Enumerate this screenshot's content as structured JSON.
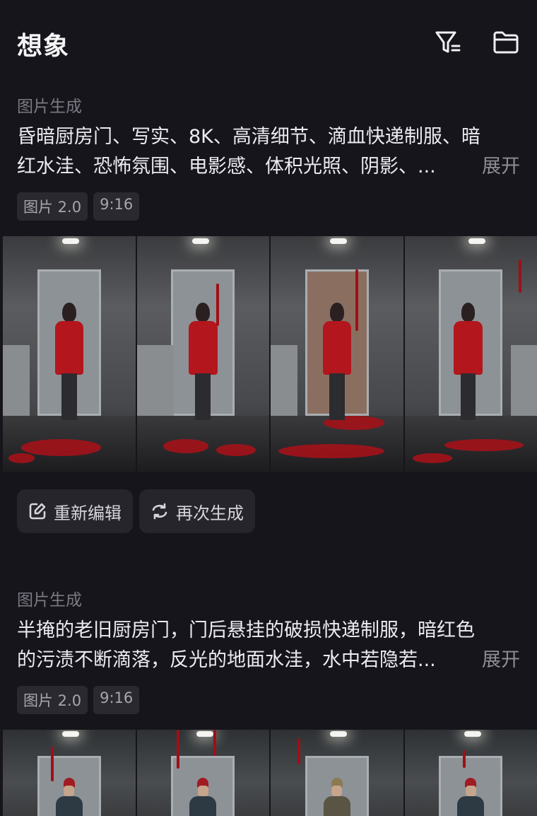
{
  "header": {
    "title": "想象",
    "filter_icon": "filter-icon",
    "folder_icon": "folder-icon"
  },
  "items": [
    {
      "label": "图片生成",
      "prompt_line1": "昏暗厨房门、写实、8K、高清细节、滴血快递制服、暗",
      "prompt_line2": "红水洼、恐怖氛围、电影感、体积光照、阴影、...",
      "expand": "展开",
      "tags": [
        "图片 2.0",
        "9:16"
      ],
      "actions": {
        "edit": "重新编辑",
        "regenerate": "再次生成"
      }
    },
    {
      "label": "图片生成",
      "prompt_line1": "半掩的老旧厨房门，门后悬挂的破损快递制服，暗红色",
      "prompt_line2": "的污渍不断滴落，反光的地面水洼，水中若隐若...",
      "expand": "展开",
      "tags": [
        "图片 2.0",
        "9:16"
      ]
    }
  ],
  "colors": {
    "background": "#16151b",
    "accent_red": "#b3161c"
  }
}
